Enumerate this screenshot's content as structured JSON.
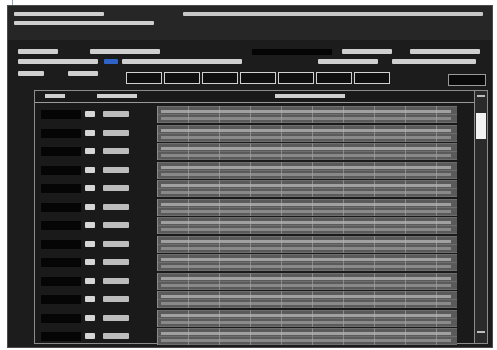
{
  "screen": {
    "colors": {
      "background": "#1c1c1c",
      "grid_fill": "#5a5a5a",
      "grid_lines": "#8a8a8a",
      "text_light": "#d6d6d6",
      "accent_blue": "#2f63c8"
    }
  }
}
